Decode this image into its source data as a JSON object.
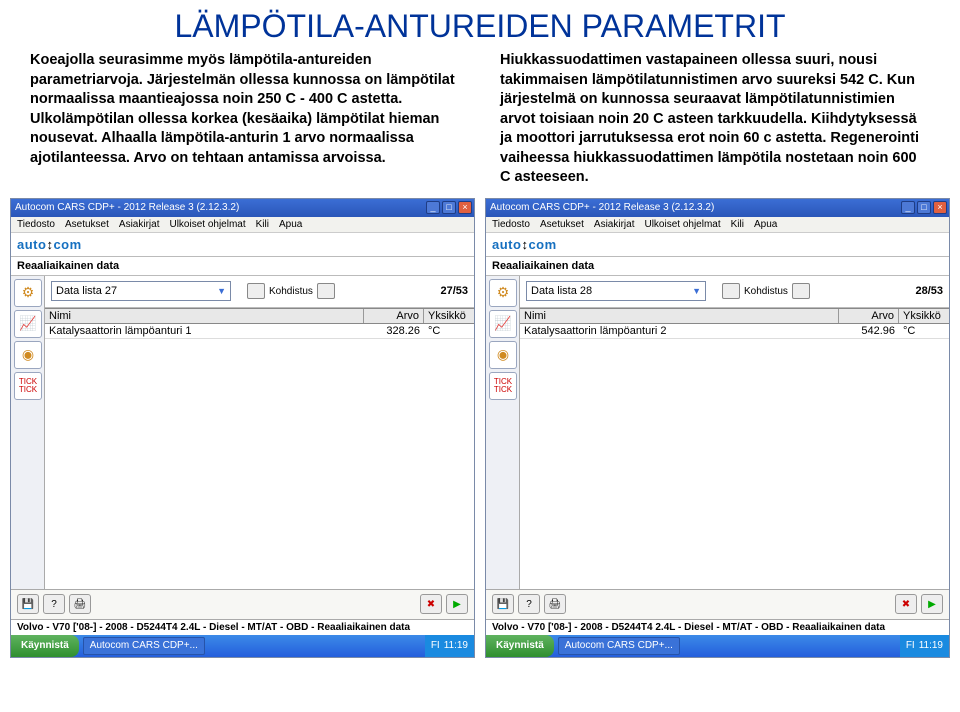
{
  "slide": {
    "title": "LÄMPÖTILA-ANTUREIDEN PARAMETRIT",
    "left_text": "Koeajolla seurasimme myös lämpötila-antureiden parametriarvoja. Järjestelmän ollessa kunnossa on lämpötilat normaalissa maantieajossa noin 250 C - 400 C astetta. Ulkolämpötilan ollessa korkea (kesäaika) lämpötilat hieman nousevat. Alhaalla lämpötila-anturin 1 arvo normaalissa ajotilanteessa. Arvo on tehtaan antamissa arvoissa.",
    "right_text": "Hiukkassuodattimen vastapaineen ollessa suuri, nousi takimmaisen lämpötilatunnistimen arvo suureksi 542 C. Kun järjestelmä on kunnossa seuraavat lämpötilatunnistimien arvot toisiaan noin 20 C asteen tarkkuudella. Kiihdytyksessä ja moottori jarrutuksessa erot noin 60 c astetta. Regenerointi vaiheessa hiukkassuodattimen lämpötila nostetaan noin 600 C asteeseen."
  },
  "app": {
    "window_title": "Autocom CARS CDP+ - 2012 Release 3 (2.12.3.2)",
    "menus": [
      "Tiedosto",
      "Asetukset",
      "Asiakirjat",
      "Ulkoiset ohjelmat",
      "Kili",
      "Apua"
    ],
    "logo_a": "auto",
    "logo_b": "com",
    "section": "Reaaliaikainen data",
    "table_headers": {
      "name": "Nimi",
      "value": "Arvo",
      "unit": "Yksikkö"
    },
    "status": "Volvo - V70 ['08-] - 2008 - D5244T4 2.4L - Diesel - MT/AT - OBD - Reaaliaikainen data",
    "start": "Käynnistä",
    "task_item": "Autocom CARS CDP+...",
    "tray_label": "FI"
  },
  "left_shot": {
    "combo": "Data lista 27",
    "combo_action": "Kohdistus",
    "counter": "27/53",
    "row_name": "Katalysaattorin lämpöanturi 1",
    "row_value": "328.26",
    "row_unit": "°C",
    "time": "11:19"
  },
  "right_shot": {
    "combo": "Data lista 28",
    "combo_action": "Kohdistus",
    "counter": "28/53",
    "row_name": "Katalysaattorin lämpöanturi 2",
    "row_value": "542.96",
    "row_unit": "°C",
    "time": "11:19"
  },
  "chart_data": {
    "type": "table",
    "title": "Reaaliaikainen data — Katalysaattorin lämpöanturit",
    "columns": [
      "Nimi",
      "Arvo",
      "Yksikkö"
    ],
    "series": [
      {
        "name": "Data lista 27",
        "values": [
          "Katalysaattorin lämpöanturi 1",
          328.26,
          "°C"
        ]
      },
      {
        "name": "Data lista 28",
        "values": [
          "Katalysaattorin lämpöanturi 2",
          542.96,
          "°C"
        ]
      }
    ]
  }
}
